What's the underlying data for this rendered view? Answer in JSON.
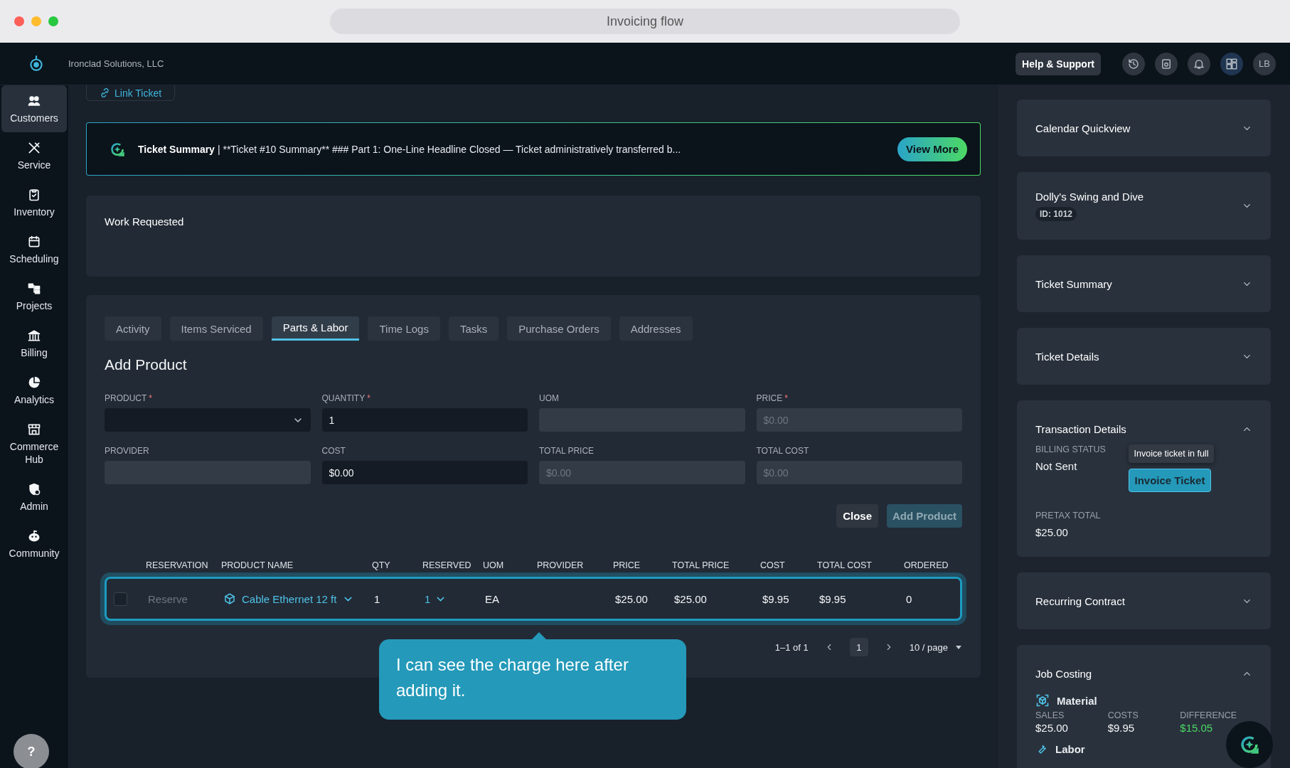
{
  "browser": {
    "title": "Invoicing flow"
  },
  "topbar": {
    "company": "Ironclad Solutions, LLC",
    "help": "Help & Support",
    "avatar": "LB"
  },
  "sidebar": {
    "items": [
      {
        "label": "Customers",
        "selected": true
      },
      {
        "label": "Service",
        "selected": false
      },
      {
        "label": "Inventory",
        "selected": false
      },
      {
        "label": "Scheduling",
        "selected": false
      },
      {
        "label": "Projects",
        "selected": false
      },
      {
        "label": "Billing",
        "selected": false
      },
      {
        "label": "Analytics",
        "selected": false
      },
      {
        "label": "Commerce Hub",
        "selected": false
      },
      {
        "label": "Admin",
        "selected": false
      },
      {
        "label": "Community",
        "selected": false
      }
    ],
    "help": "?"
  },
  "link_ticket": "Link Ticket",
  "summary_banner": {
    "title": "Ticket Summary",
    "text": "| **Ticket #10 Summary** ### Part 1: One-Line Headline Closed — Ticket administratively transferred b...",
    "button": "View More"
  },
  "work_requested": {
    "title": "Work Requested"
  },
  "tabs": [
    {
      "label": "Activity",
      "selected": false
    },
    {
      "label": "Items Serviced",
      "selected": false
    },
    {
      "label": "Parts & Labor",
      "selected": true
    },
    {
      "label": "Time Logs",
      "selected": false
    },
    {
      "label": "Tasks",
      "selected": false
    },
    {
      "label": "Purchase Orders",
      "selected": false
    },
    {
      "label": "Addresses",
      "selected": false
    }
  ],
  "add_product": {
    "title": "Add Product",
    "fields": [
      {
        "label": "PRODUCT",
        "required_mark": "*",
        "kind": "select",
        "disabled": false
      },
      {
        "label": "QUANTITY",
        "required_mark": "*",
        "kind": "input",
        "disabled": false,
        "value": "1"
      },
      {
        "label": "UOM",
        "kind": "input",
        "disabled": true
      },
      {
        "label": "PRICE",
        "required_mark": "*",
        "kind": "input",
        "disabled": true,
        "placeholder": "$0.00"
      },
      {
        "label": "PROVIDER",
        "kind": "input",
        "disabled": true
      },
      {
        "label": "COST",
        "kind": "input",
        "disabled": false,
        "value": "$0.00"
      },
      {
        "label": "TOTAL PRICE",
        "kind": "input",
        "disabled": true,
        "placeholder": "$0.00"
      },
      {
        "label": "TOTAL COST",
        "kind": "input",
        "disabled": true,
        "placeholder": "$0.00"
      }
    ],
    "close": "Close",
    "add": {
      "label": "Add Product",
      "disabled": true
    }
  },
  "table": {
    "columns": [
      "RESERVATION",
      "PRODUCT NAME",
      "QTY",
      "RESERVED",
      "UOM",
      "PROVIDER",
      "PRICE",
      "TOTAL PRICE",
      "COST",
      "TOTAL COST",
      "ORDERED"
    ],
    "rows": [
      {
        "checked": false,
        "highlighted": true,
        "reservation": "Reserve",
        "product": "Cable Ethernet 12 ft",
        "qty": "1",
        "reserved": "1",
        "uom": "EA",
        "price": "$25.00",
        "total_price": "$25.00",
        "cost": "$9.95",
        "total_cost": "$9.95",
        "ordered": "0"
      }
    ]
  },
  "pagination": {
    "range": "1–1 of 1",
    "pages": [
      {
        "label": "1",
        "selected": true
      }
    ],
    "page_size": "10 / page"
  },
  "callout": "I can see the charge here after adding it.",
  "right_panel": {
    "cards": [
      {
        "kind": "simple",
        "title": "Calendar Quickview",
        "expanded": false
      },
      {
        "kind": "simple",
        "title": "Dolly's Swing and Dive",
        "badge": "ID: 1012",
        "expanded": false
      },
      {
        "kind": "simple",
        "title": "Ticket Summary",
        "expanded": false
      },
      {
        "kind": "simple",
        "title": "Ticket Details",
        "expanded": false
      },
      {
        "kind": "transaction",
        "title": "Transaction Details",
        "expanded": true,
        "billing_label": "BILLING STATUS",
        "billing_value": "Not Sent",
        "tooltip": "Invoice ticket in full",
        "button": "Invoice Ticket",
        "pretax_label": "PRETAX TOTAL",
        "pretax_value": "$25.00"
      },
      {
        "kind": "simple",
        "title": "Recurring Contract",
        "expanded": false
      },
      {
        "kind": "costing",
        "title": "Job Costing",
        "expanded": true,
        "material": "Material",
        "metrics": [
          {
            "label": "SALES",
            "value": "$25.00"
          },
          {
            "label": "COSTS",
            "value": "$9.95"
          },
          {
            "label": "DIFFERENCE",
            "value": "$15.05",
            "positive": true
          }
        ],
        "labor": "Labor"
      }
    ]
  }
}
